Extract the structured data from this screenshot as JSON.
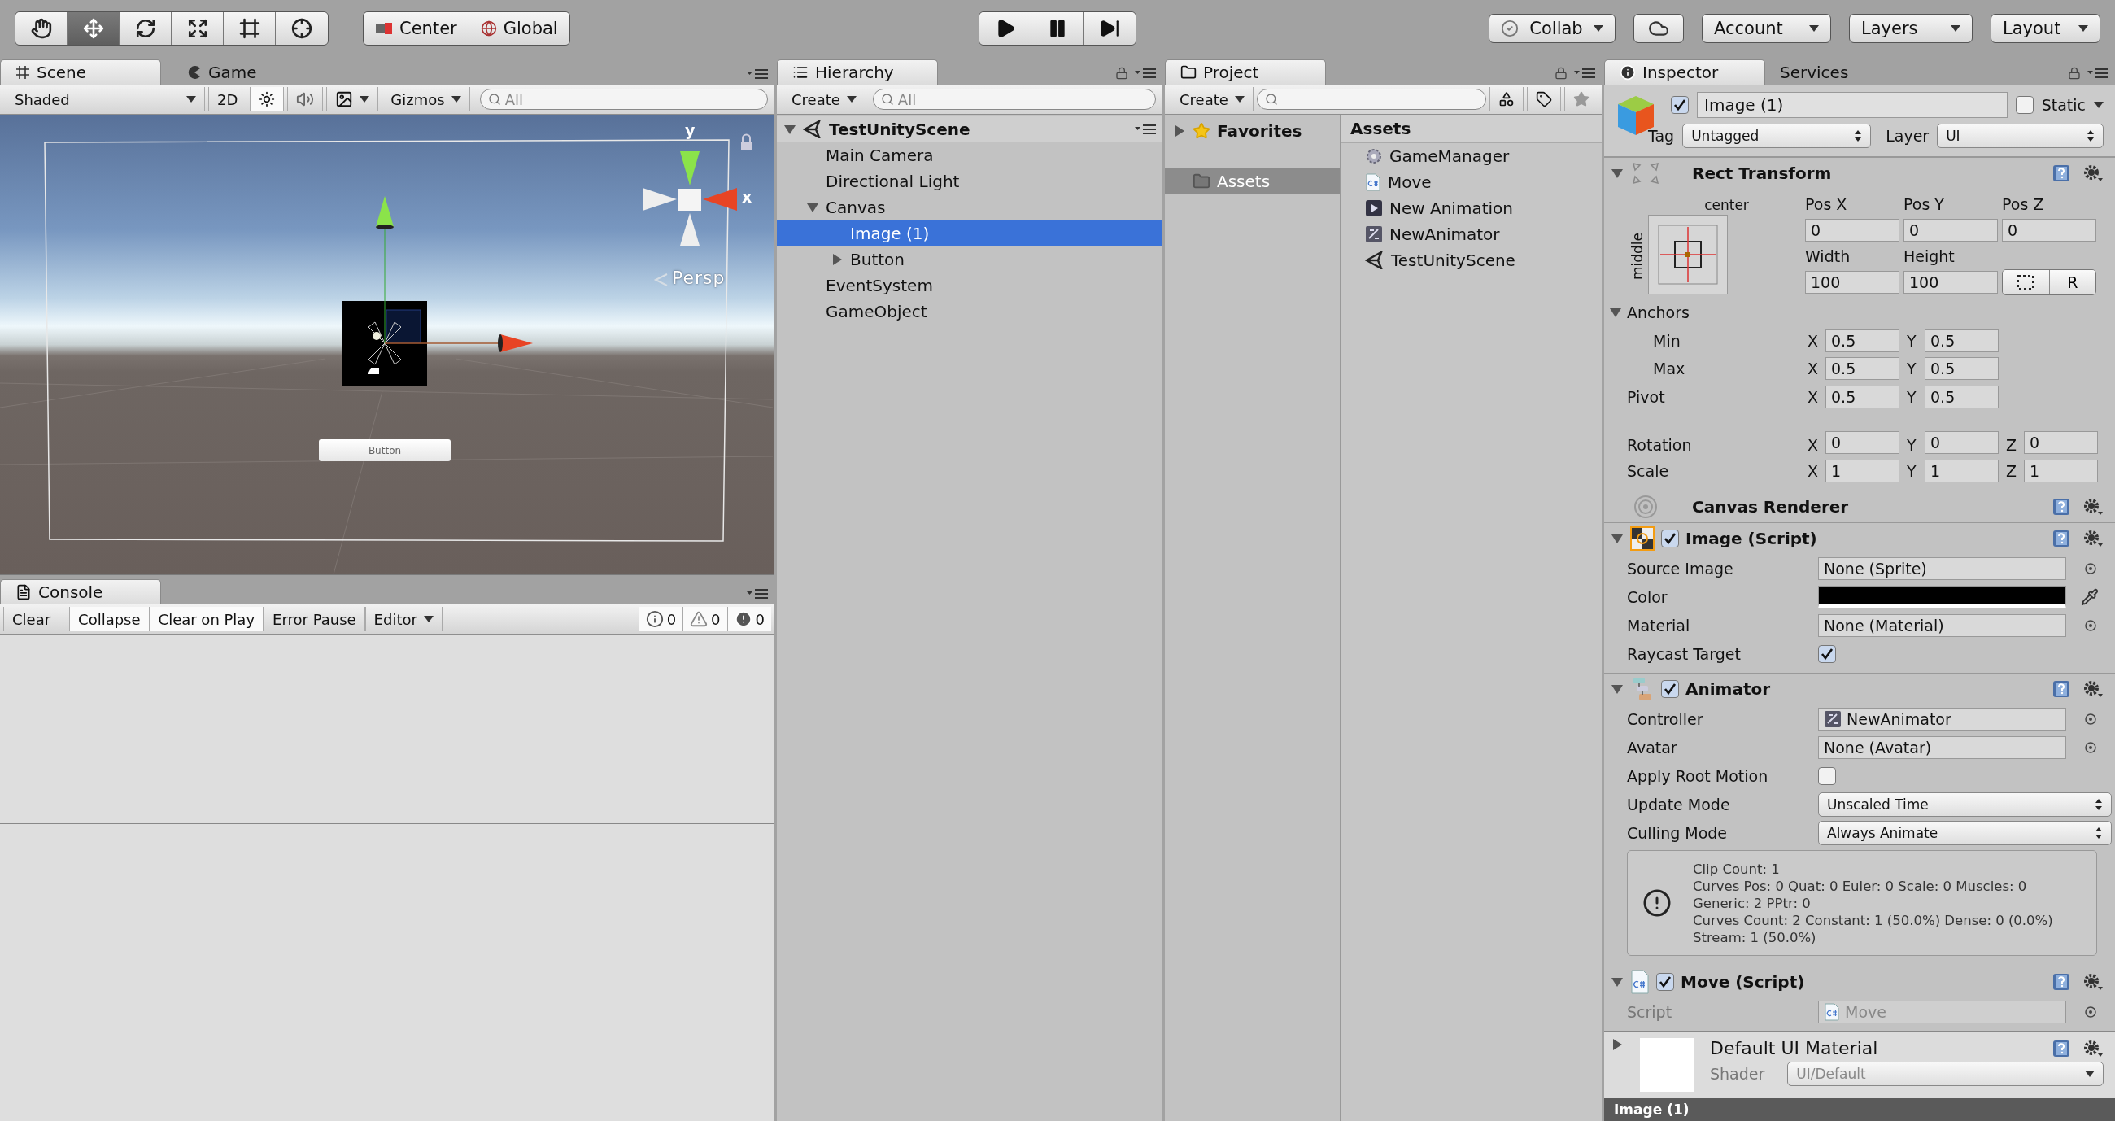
{
  "toolbar": {
    "tools": [
      {
        "kind": "hand",
        "selected": false
      },
      {
        "kind": "move",
        "selected": true
      },
      {
        "kind": "rotate",
        "selected": false
      },
      {
        "kind": "scale",
        "selected": false
      },
      {
        "kind": "rect",
        "selected": false
      },
      {
        "kind": "transform",
        "selected": false
      }
    ],
    "pivot": [
      {
        "kind": "pivot",
        "label": "Center"
      },
      {
        "kind": "space",
        "label": "Global"
      }
    ],
    "collab": "Collab",
    "menus": [
      "Account",
      "Layers",
      "Layout"
    ]
  },
  "scene": {
    "tabs": [
      {
        "kind": "scene",
        "label": "Scene",
        "selected": true
      },
      {
        "kind": "game",
        "label": "Game",
        "selected": false
      }
    ],
    "shading": "Shaded",
    "mode_2d": "2D",
    "lighting_on": true,
    "audio_on": false,
    "gizmos": "Gizmos",
    "search": {
      "placeholder": "All"
    },
    "view": {
      "axis_y": "y",
      "axis_x": "x",
      "projection": "Persp",
      "button_text": "Button"
    }
  },
  "console": {
    "tab": "Console",
    "buttons": [
      {
        "label": "Clear",
        "on": false
      },
      {
        "label": "Collapse",
        "on": true
      },
      {
        "label": "Clear on Play",
        "on": true
      },
      {
        "label": "Error Pause",
        "on": false
      }
    ],
    "source": "Editor",
    "counters": [
      {
        "kind": "info",
        "count": "0"
      },
      {
        "kind": "warning",
        "count": "0"
      },
      {
        "kind": "error",
        "count": "0"
      }
    ]
  },
  "hierarchy": {
    "tab": "Hierarchy",
    "create": "Create",
    "search": {
      "placeholder": "All"
    },
    "scene": {
      "name": "TestUnityScene",
      "expanded": true
    },
    "items": [
      {
        "name": "Main Camera",
        "selected": false
      },
      {
        "name": "Directional Light",
        "selected": false
      },
      {
        "name": "Canvas",
        "selected": false,
        "expanded": true,
        "children": [
          {
            "name": "Image (1)",
            "selected": true
          },
          {
            "name": "Button",
            "selected": false,
            "expanded": false
          }
        ]
      },
      {
        "name": "EventSystem",
        "selected": false
      },
      {
        "name": "GameObject",
        "selected": false
      }
    ]
  },
  "project": {
    "tab": "Project",
    "create": "Create",
    "favorites": {
      "label": "Favorites",
      "expanded": false
    },
    "folders": [
      {
        "name": "Assets",
        "selected": true
      }
    ],
    "path": "Assets",
    "assets": [
      {
        "kind": "manager",
        "name": "GameManager"
      },
      {
        "kind": "csharp",
        "name": "Move"
      },
      {
        "kind": "animation",
        "name": "New Animation"
      },
      {
        "kind": "animator",
        "name": "NewAnimator"
      },
      {
        "kind": "scene",
        "name": "TestUnityScene"
      }
    ]
  },
  "inspector": {
    "tabs": [
      {
        "label": "Inspector",
        "selected": true
      },
      {
        "label": "Services",
        "selected": false
      }
    ],
    "object": {
      "active": true,
      "name": "Image (1)",
      "static": false,
      "static_label": "Static",
      "tag_label": "Tag",
      "tag": "Untagged",
      "layer_label": "Layer",
      "layer": "UI"
    },
    "components": [
      {
        "kind": "rect",
        "title": "Rect Transform",
        "expanded": true,
        "anchor_h": "center",
        "anchor_v": "middle",
        "position": [
          {
            "label": "Pos X",
            "value": "0"
          },
          {
            "label": "Pos Y",
            "value": "0"
          },
          {
            "label": "Pos Z",
            "value": "0"
          }
        ],
        "size": [
          {
            "label": "Width",
            "value": "100"
          },
          {
            "label": "Height",
            "value": "100"
          }
        ],
        "raw_button": "R",
        "anchors": {
          "label": "Anchors",
          "expanded": true,
          "children": [
            {
              "label": "Min",
              "axes": [
                {
                  "axis": "X",
                  "value": "0.5"
                },
                {
                  "axis": "Y",
                  "value": "0.5"
                }
              ]
            },
            {
              "label": "Max",
              "axes": [
                {
                  "axis": "X",
                  "value": "0.5"
                },
                {
                  "axis": "Y",
                  "value": "0.5"
                }
              ]
            }
          ]
        },
        "vectors": [
          {
            "label": "Pivot",
            "axes": [
              {
                "axis": "X",
                "value": "0.5"
              },
              {
                "axis": "Y",
                "value": "0.5"
              }
            ]
          },
          {
            "label": "Rotation",
            "axes": [
              {
                "axis": "X",
                "value": "0"
              },
              {
                "axis": "Y",
                "value": "0"
              },
              {
                "axis": "Z",
                "value": "0"
              }
            ]
          },
          {
            "label": "Scale",
            "axes": [
              {
                "axis": "X",
                "value": "1"
              },
              {
                "axis": "Y",
                "value": "1"
              },
              {
                "axis": "Z",
                "value": "1"
              }
            ]
          }
        ]
      },
      {
        "kind": "renderer",
        "title": "Canvas Renderer"
      },
      {
        "kind": "image",
        "title": "Image (Script)",
        "enabled": true,
        "expanded": true,
        "fields": [
          {
            "kind": "object",
            "label": "Source Image",
            "value": "None (Sprite)"
          },
          {
            "kind": "color",
            "label": "Color",
            "color": "#000000"
          },
          {
            "kind": "object",
            "label": "Material",
            "value": "None (Material)"
          },
          {
            "kind": "checkbox",
            "label": "Raycast Target",
            "checked": true
          }
        ]
      },
      {
        "kind": "animator",
        "title": "Animator",
        "enabled": true,
        "expanded": true,
        "fields": [
          {
            "kind": "asset",
            "label": "Controller",
            "value": "NewAnimator"
          },
          {
            "kind": "object",
            "label": "Avatar",
            "value": "None (Avatar)"
          },
          {
            "kind": "checkbox",
            "label": "Apply Root Motion",
            "checked": false
          },
          {
            "kind": "dropdown",
            "label": "Update Mode",
            "value": "Unscaled Time"
          },
          {
            "kind": "dropdown",
            "label": "Culling Mode",
            "value": "Always Animate"
          },
          {
            "kind": "info",
            "lines": [
              "Clip Count: 1",
              "Curves Pos: 0 Quat: 0 Euler: 0 Scale: 0 Muscles: 0",
              "Generic: 2 PPtr: 0",
              "Curves Count: 2 Constant: 1 (50.0%) Dense: 0 (0.0%)",
              "Stream: 1 (50.0%)"
            ]
          }
        ]
      },
      {
        "kind": "script",
        "title": "Move (Script)",
        "enabled": true,
        "expanded": true,
        "fields": [
          {
            "kind": "script",
            "label": "Script",
            "value": "Move"
          }
        ]
      }
    ],
    "material": {
      "title": "Default UI Material",
      "expanded": false,
      "shader_label": "Shader",
      "shader": "UI/Default"
    },
    "preview": "Image (1)"
  }
}
